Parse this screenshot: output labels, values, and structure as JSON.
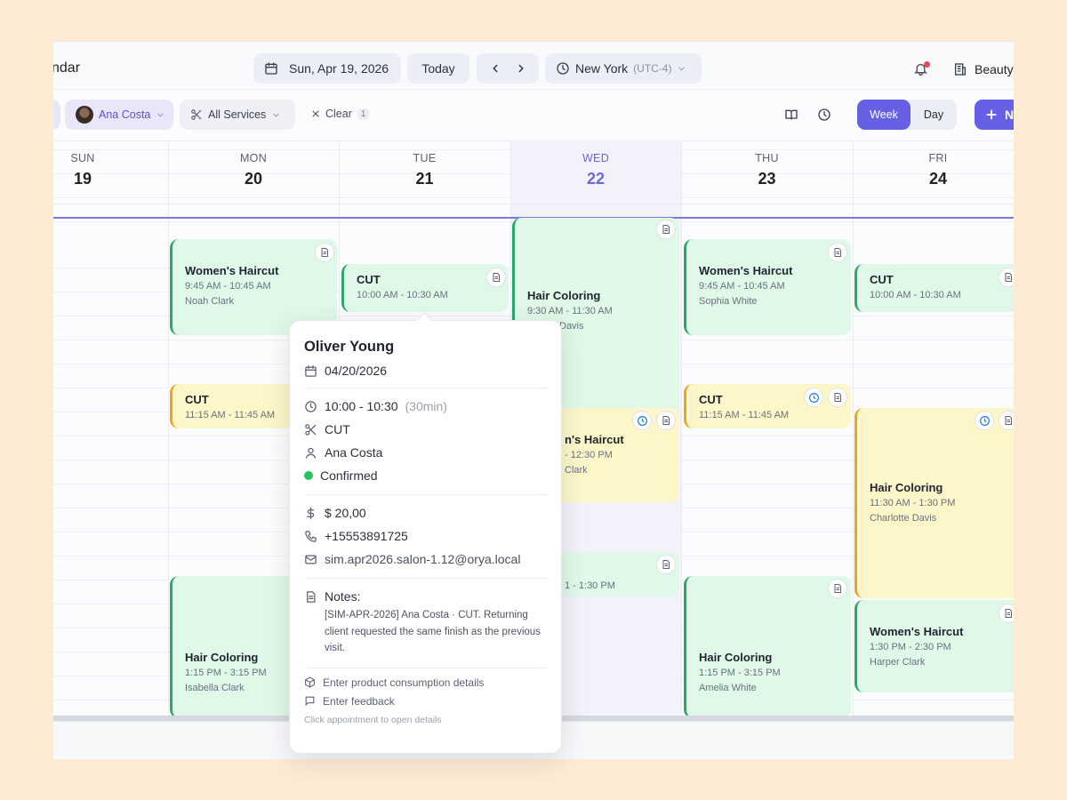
{
  "header": {
    "app_title": "ndar",
    "date": "Sun, Apr 19, 2026",
    "today_label": "Today",
    "timezone": "New York",
    "timezone_offset": "(UTC-4)",
    "business": "Beauty"
  },
  "filters": {
    "staff": "Ana Costa",
    "services": "All Services",
    "clear_label": "Clear",
    "clear_count": "1"
  },
  "view": {
    "week": "Week",
    "day": "Day",
    "new_label": "N"
  },
  "days": [
    {
      "name": "SUN",
      "num": "19"
    },
    {
      "name": "MON",
      "num": "20"
    },
    {
      "name": "TUE",
      "num": "21"
    },
    {
      "name": "WED",
      "num": "22"
    },
    {
      "name": "THU",
      "num": "23"
    },
    {
      "name": "FRI",
      "num": "24"
    }
  ],
  "events": {
    "mon1": {
      "title": "Women's Haircut",
      "time": "9:45 AM - 10:45 AM",
      "client": "Noah Clark"
    },
    "mon2": {
      "title": "CUT",
      "time": "11:15 AM - 11:45 AM"
    },
    "mon3": {
      "title": "Hair Coloring",
      "time": "1:15 PM - 3:15 PM",
      "client": "Isabella Clark"
    },
    "tue1": {
      "title": "CUT",
      "time": "10:00 AM - 10:30 AM"
    },
    "wed1": {
      "title": "Hair Coloring",
      "time": "9:30 AM - 11:30 AM",
      "client": "Davis"
    },
    "wed2": {
      "title": "n's Haircut",
      "time": "- 12:30 PM",
      "client": "Clark"
    },
    "wed3": {
      "time": "1 - 1:30 PM"
    },
    "thu1": {
      "title": "Women's Haircut",
      "time": "9:45 AM - 10:45 AM",
      "client": "Sophia White"
    },
    "thu2": {
      "title": "CUT",
      "time": "11:15 AM - 11:45 AM"
    },
    "thu3": {
      "title": "Hair Coloring",
      "time": "1:15 PM - 3:15 PM",
      "client": "Amelia White"
    },
    "fri1": {
      "title": "CUT",
      "time": "10:00 AM - 10:30 AM"
    },
    "fri2": {
      "title": "Hair Coloring",
      "time": "11:30 AM - 1:30 PM",
      "client": "Charlotte Davis"
    },
    "fri3": {
      "title": "Women's Haircut",
      "time": "1:30 PM - 2:30 PM",
      "client": "Harper Clark"
    }
  },
  "popover": {
    "client": "Oliver Young",
    "date": "04/20/2026",
    "time": "10:00 - 10:30",
    "duration": "(30min)",
    "service": "CUT",
    "staff": "Ana Costa",
    "status": "Confirmed",
    "price": "$ 20,00",
    "phone": "+15553891725",
    "email": "sim.apr2026.salon-1.12@orya.local",
    "notes_label": "Notes:",
    "notes": "[SIM-APR-2026] Ana Costa · CUT. Returning client requested the same finish as the previous visit.",
    "product_link": "Enter product consumption details",
    "feedback_link": "Enter feedback",
    "hint": "Click appointment to open details"
  },
  "colors": {
    "accent": "#6560e4",
    "event_green": "#dff8e7",
    "event_yellow": "#fcf6c9",
    "status_confirmed": "#22c55e"
  },
  "icons": [
    "calendar-icon",
    "clock-icon",
    "chevron-left-icon",
    "chevron-right-icon",
    "chevron-down-icon",
    "bell-icon",
    "building-icon",
    "scissors-icon",
    "close-icon",
    "book-icon",
    "plus-icon",
    "note-icon",
    "user-icon",
    "dollar-icon",
    "phone-icon",
    "mail-icon",
    "box-icon",
    "message-icon"
  ]
}
